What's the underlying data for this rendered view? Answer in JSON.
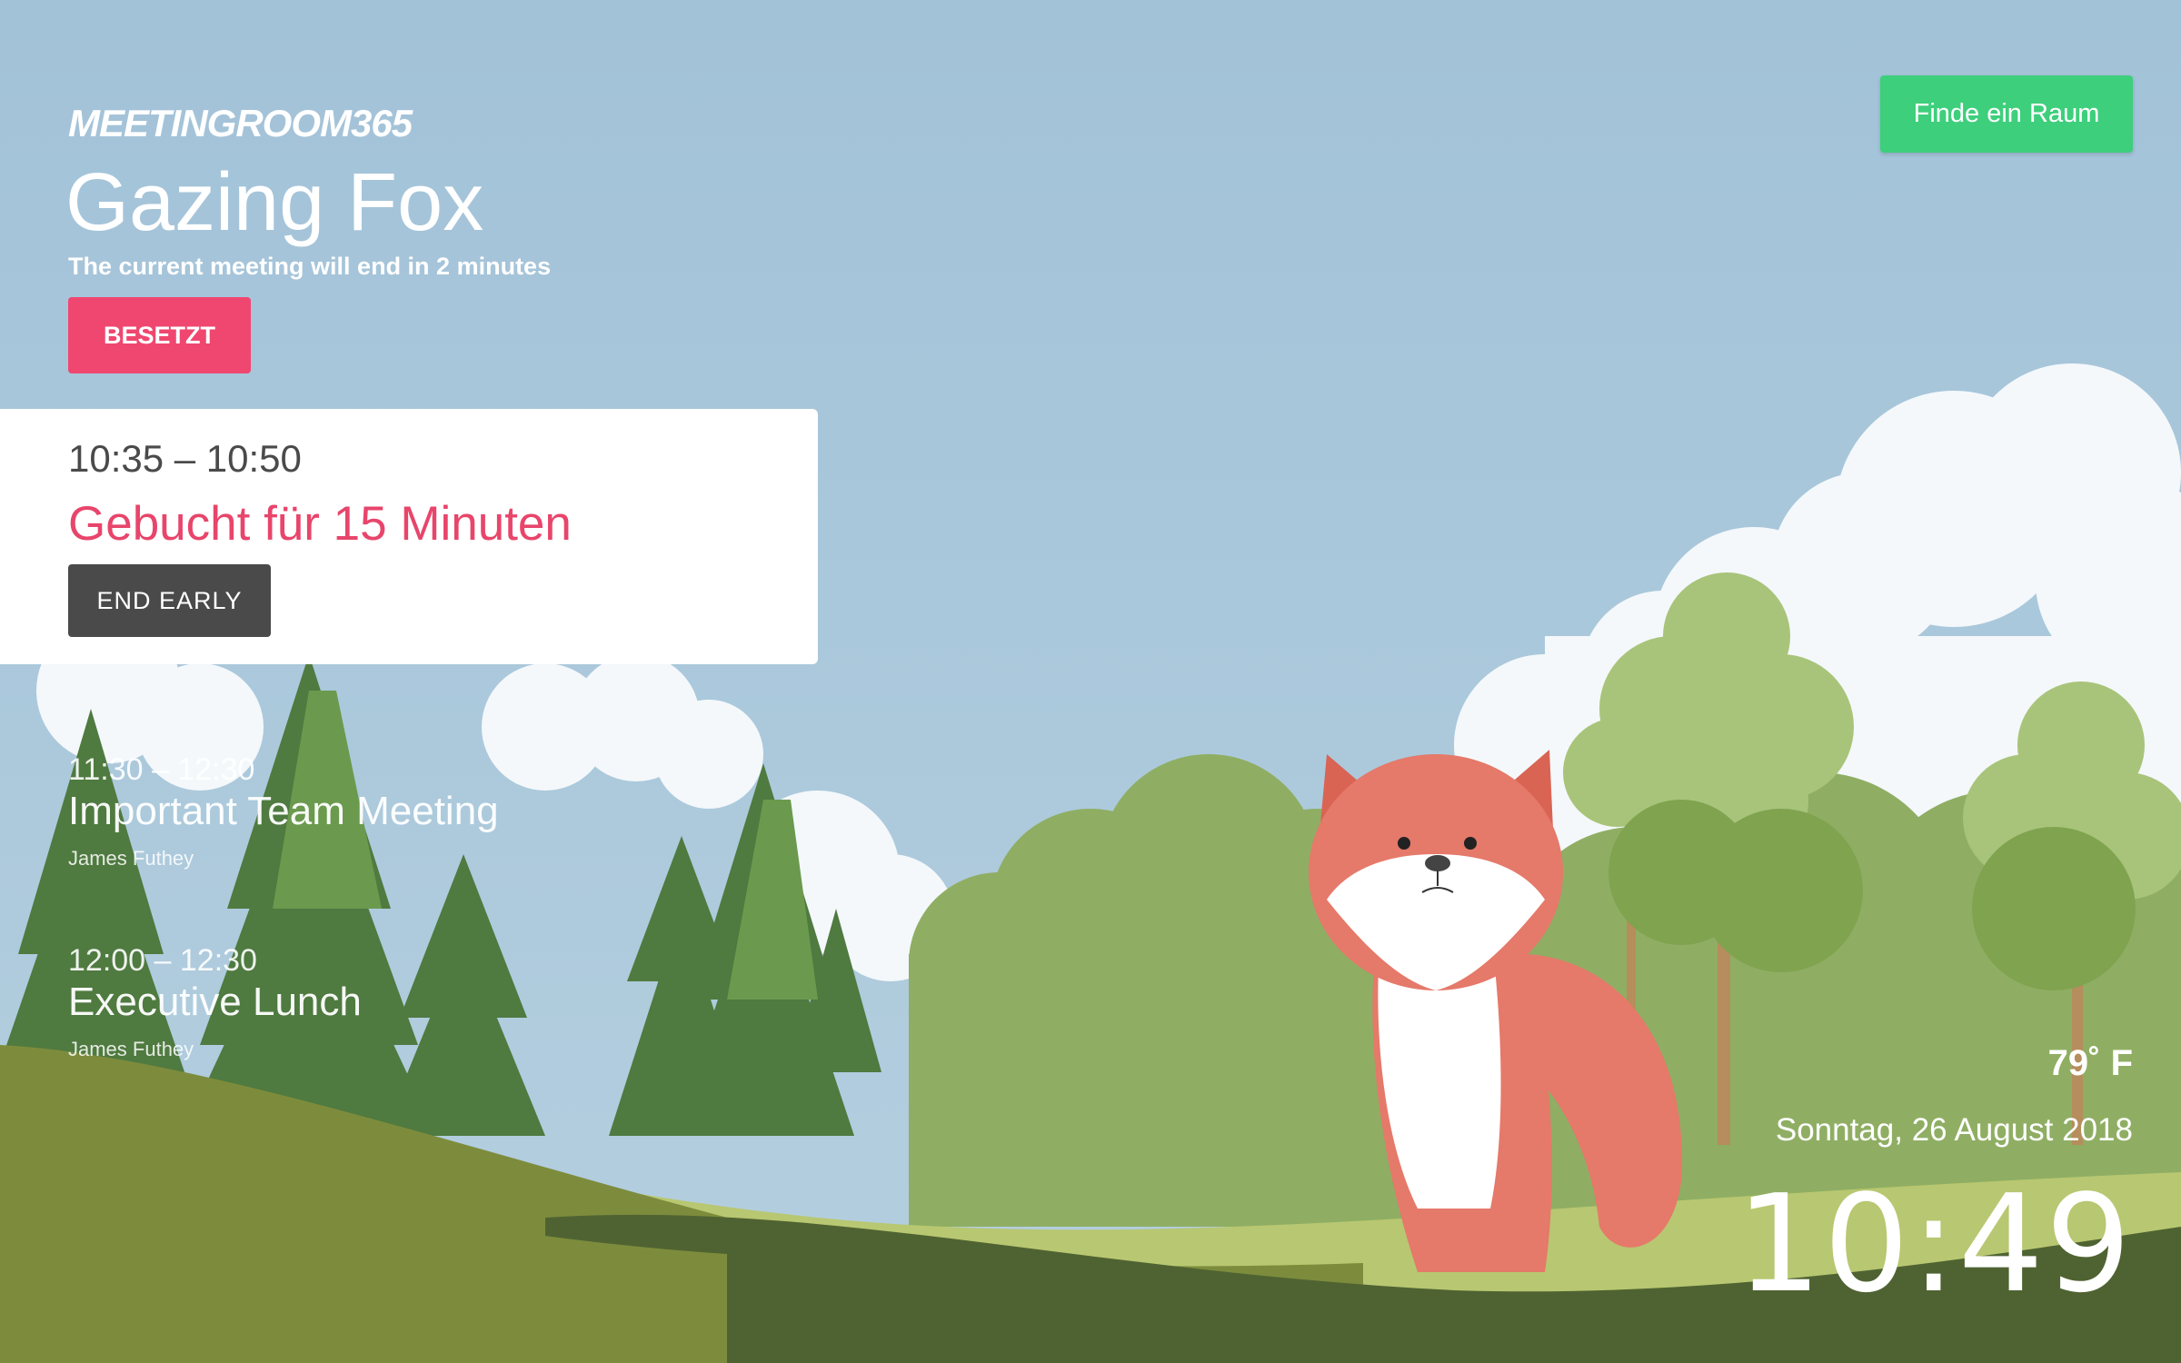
{
  "app": {
    "logo_text": "MEETINGROOM365",
    "find_room_label": "Finde ein Raum"
  },
  "room": {
    "name": "Gazing Fox",
    "subtitle": "The current meeting will end in 2 minutes",
    "status_label": "BESETZT"
  },
  "current_meeting": {
    "time_range": "10:35 – 10:50",
    "status_text": "Gebucht für 15 Minuten",
    "end_early_label": "END EARLY"
  },
  "upcoming_meetings": [
    {
      "time_range": "11:30 – 12:30",
      "title": "Important Team Meeting",
      "host": "James Futhey"
    },
    {
      "time_range": "12:00 – 12:30",
      "title": "Executive Lunch",
      "host": "James Futhey"
    }
  ],
  "info": {
    "weather": "79˚ F",
    "date": "Sonntag, 26 August 2018",
    "time": "10:49"
  },
  "colors": {
    "sky": "#a3c3d8",
    "occupied": "#ef476f",
    "find_button": "#3ecf7c",
    "end_button": "#4a4a4a",
    "fox": "#e5796a"
  },
  "illustration": {
    "description_icon": "fox-illustration"
  }
}
